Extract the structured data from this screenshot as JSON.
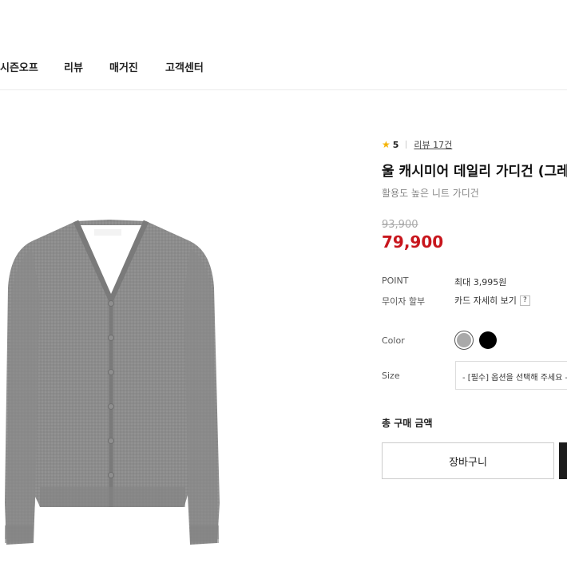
{
  "nav": {
    "items": [
      "시즌오프",
      "리뷰",
      "매거진",
      "고객센터"
    ]
  },
  "product": {
    "rating": "5",
    "review_link": "리뷰 17건",
    "title": "울 캐시미어 데일리 가디건 (그레",
    "subtitle": "활용도 높은 니트 가디건",
    "original_price": "93,900",
    "sale_price": "79,900",
    "point_label": "POINT",
    "point_value": "최대 3,995원",
    "installment_label": "무이자 할부",
    "installment_value": "카드 자세히 보기",
    "help_icon": "?",
    "color_label": "Color",
    "colors": [
      "#a9a9a9",
      "#000000"
    ],
    "size_label": "Size",
    "size_select_value": "- [필수] 옵션을 선택해 주세요 -",
    "total_label": "총 구매 금액",
    "cart_button": "장바구니"
  },
  "icons": {
    "star": "star-icon",
    "help": "question-icon"
  },
  "accent_color": "#c8161d"
}
